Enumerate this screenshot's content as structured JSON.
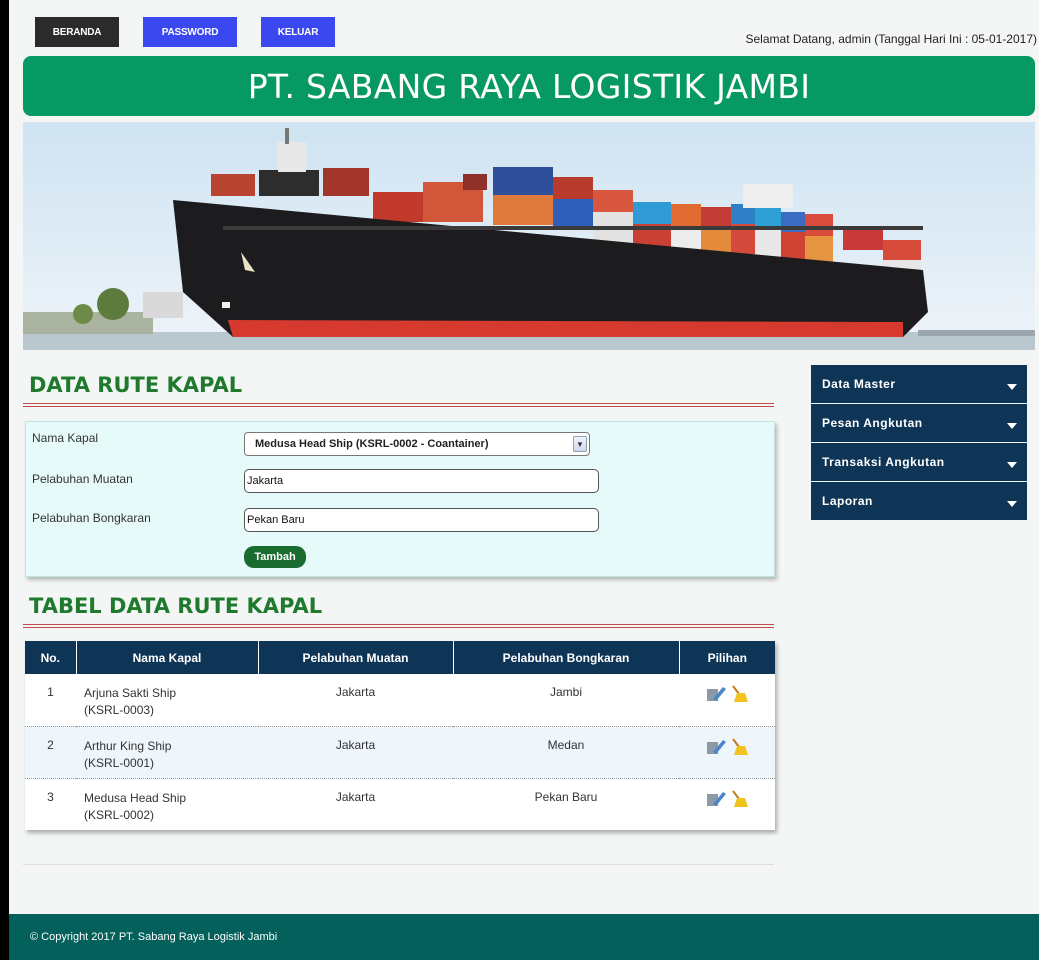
{
  "nav": {
    "home": "BERANDA",
    "password": "PASSWORD",
    "logout": "KELUAR"
  },
  "welcome": "Selamat Datang, admin (Tanggal Hari Ini : 05-01-2017)",
  "header": {
    "title": "PT. SABANG RAYA LOGISTIK JAMBI"
  },
  "form_section": {
    "title": "DATA RUTE KAPAL"
  },
  "form": {
    "ship_label": "Nama Kapal",
    "ship_value": "Medusa Head Ship (KSRL-0002 - Coantainer)",
    "load_port_label": "Pelabuhan Muatan",
    "load_port_value": "Jakarta",
    "unload_port_label": "Pelabuhan Bongkaran",
    "unload_port_value": "Pekan Baru",
    "submit_label": "Tambah"
  },
  "table_section": {
    "title": "TABEL DATA RUTE KAPAL"
  },
  "table": {
    "headers": {
      "no": "No.",
      "ship": "Nama Kapal",
      "load": "Pelabuhan Muatan",
      "unload": "Pelabuhan Bongkaran",
      "action": "Pilihan"
    },
    "rows": [
      {
        "no": "1",
        "ship": "Arjuna Sakti Ship",
        "code": "(KSRL-0003)",
        "load": "Jakarta",
        "unload": "Jambi"
      },
      {
        "no": "2",
        "ship": "Arthur King Ship",
        "code": "(KSRL-0001)",
        "load": "Jakarta",
        "unload": "Medan"
      },
      {
        "no": "3",
        "ship": "Medusa Head Ship",
        "code": "(KSRL-0002)",
        "load": "Jakarta",
        "unload": "Pekan Baru"
      }
    ]
  },
  "sidebar": {
    "items": [
      {
        "label": "Data Master"
      },
      {
        "label": "Pesan Angkutan"
      },
      {
        "label": "Transaksi Angkutan"
      },
      {
        "label": "Laporan"
      }
    ]
  },
  "footer": {
    "text": "© Copyright 2017 PT. Sabang Raya Logistik Jambi"
  },
  "colors": {
    "header_green": "#079963",
    "nav_blue": "#3b48f0",
    "menu_navy": "#0f3556",
    "footer_teal": "#03605a",
    "title_green": "#1f7a2e"
  },
  "icons": {
    "edit": "edit-icon",
    "delete": "broom-delete-icon",
    "dropdown": "chevron-down-icon"
  }
}
